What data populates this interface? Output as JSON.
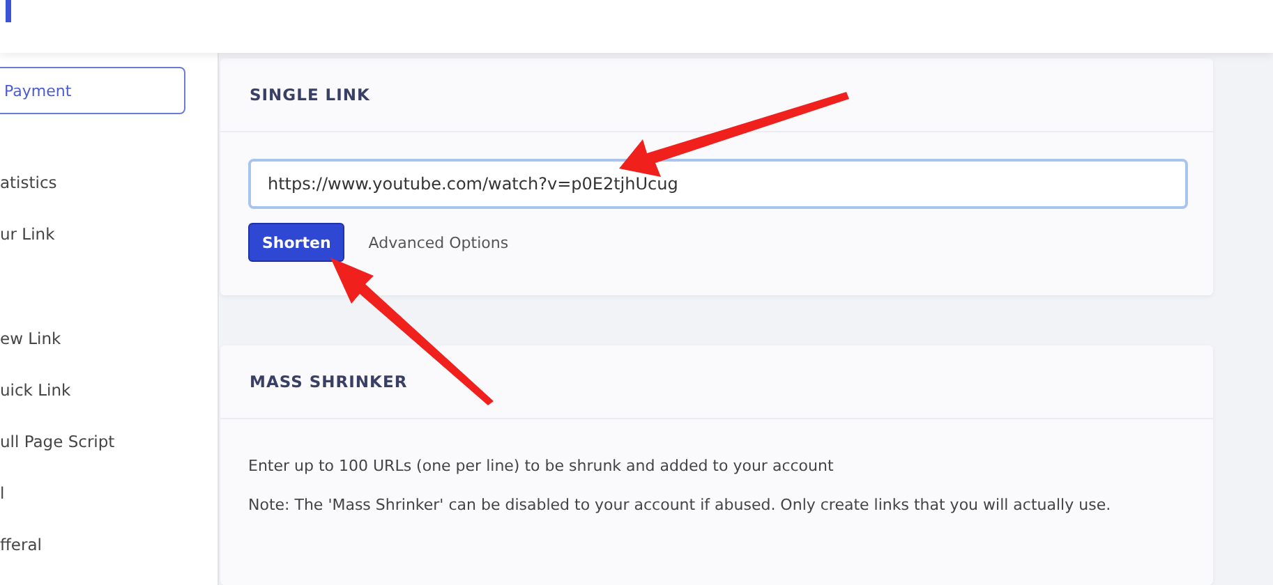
{
  "sidebar": {
    "payment_button": "Payment",
    "groups": [
      [
        "atistics",
        "ur Link"
      ],
      [
        "ew Link",
        "uick Link",
        "ull Page Script",
        "l",
        "fferal"
      ]
    ]
  },
  "single_link": {
    "title": "SINGLE LINK",
    "url": "https://www.youtube.com/watch?v=p0E2tjhUcug",
    "button": "Shorten",
    "advanced": "Advanced Options"
  },
  "mass_shrinker": {
    "title": "MASS SHRINKER",
    "paragraphs": [
      "Enter up to 100 URLs (one per line) to be shrunk and added to your account",
      "Note: The 'Mass Shrinker' can be disabled to your account if abused. Only create links that you will actually use."
    ]
  }
}
